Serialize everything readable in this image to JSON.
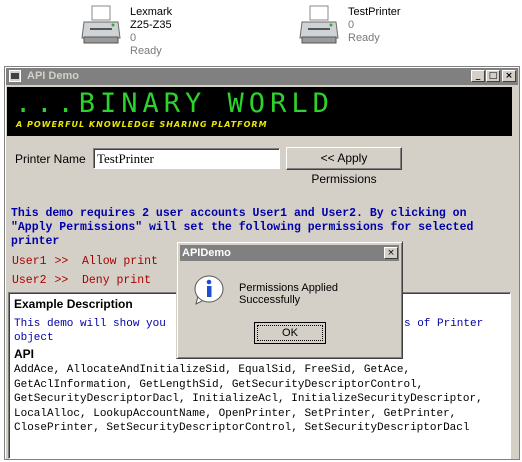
{
  "printers": [
    {
      "name": "Lexmark Z25-Z35",
      "jobs": "0",
      "status": "Ready"
    },
    {
      "name": "TestPrinter",
      "jobs": "0",
      "status": "Ready"
    }
  ],
  "window": {
    "title": "API Demo",
    "min": "_",
    "max": "□",
    "close": "×"
  },
  "banner": {
    "title": "...BINARY WORLD",
    "tagline": "A POWERFUL KNOWLEDGE SHARING PLATFORM"
  },
  "form": {
    "printer_label": "Printer Name",
    "printer_value": "TestPrinter",
    "apply_button": "<< Apply Permissions"
  },
  "info": "This demo requires 2 user accounts User1 and User2. By clicking on \"Apply Permissions\" will set the following permissions for selected printer",
  "users": [
    {
      "name": "User1",
      "arrow": ">>",
      "perm": "Allow print"
    },
    {
      "name": "User2",
      "arrow": ">>",
      "perm": "Deny print"
    }
  ],
  "panel": {
    "heading": "Example Description",
    "desc_left": "This demo will show you",
    "desc_right": "s of Printer",
    "desc_line2": "object",
    "api_heading": "API",
    "api_text": "AddAce, AllocateAndInitializeSid, EqualSid, FreeSid, GetAce, GetAclInformation, GetLengthSid, GetSecurityDescriptorControl, GetSecurityDescriptorDacl, InitializeAcl, InitializeSecurityDescriptor, LocalAlloc, LookupAccountName, OpenPrinter, SetPrinter, GetPrinter, ClosePrinter, SetSecurityDescriptorControl, SetSecurityDescriptorDacl"
  },
  "dialog": {
    "title": "APIDemo",
    "close": "×",
    "message": "Permissions Applied Successfully",
    "ok": "OK"
  },
  "colors": {
    "accent_blue": "#0000aa",
    "accent_red": "#aa0000",
    "banner_green": "#2cd32c",
    "banner_yellow": "#e8e800"
  }
}
